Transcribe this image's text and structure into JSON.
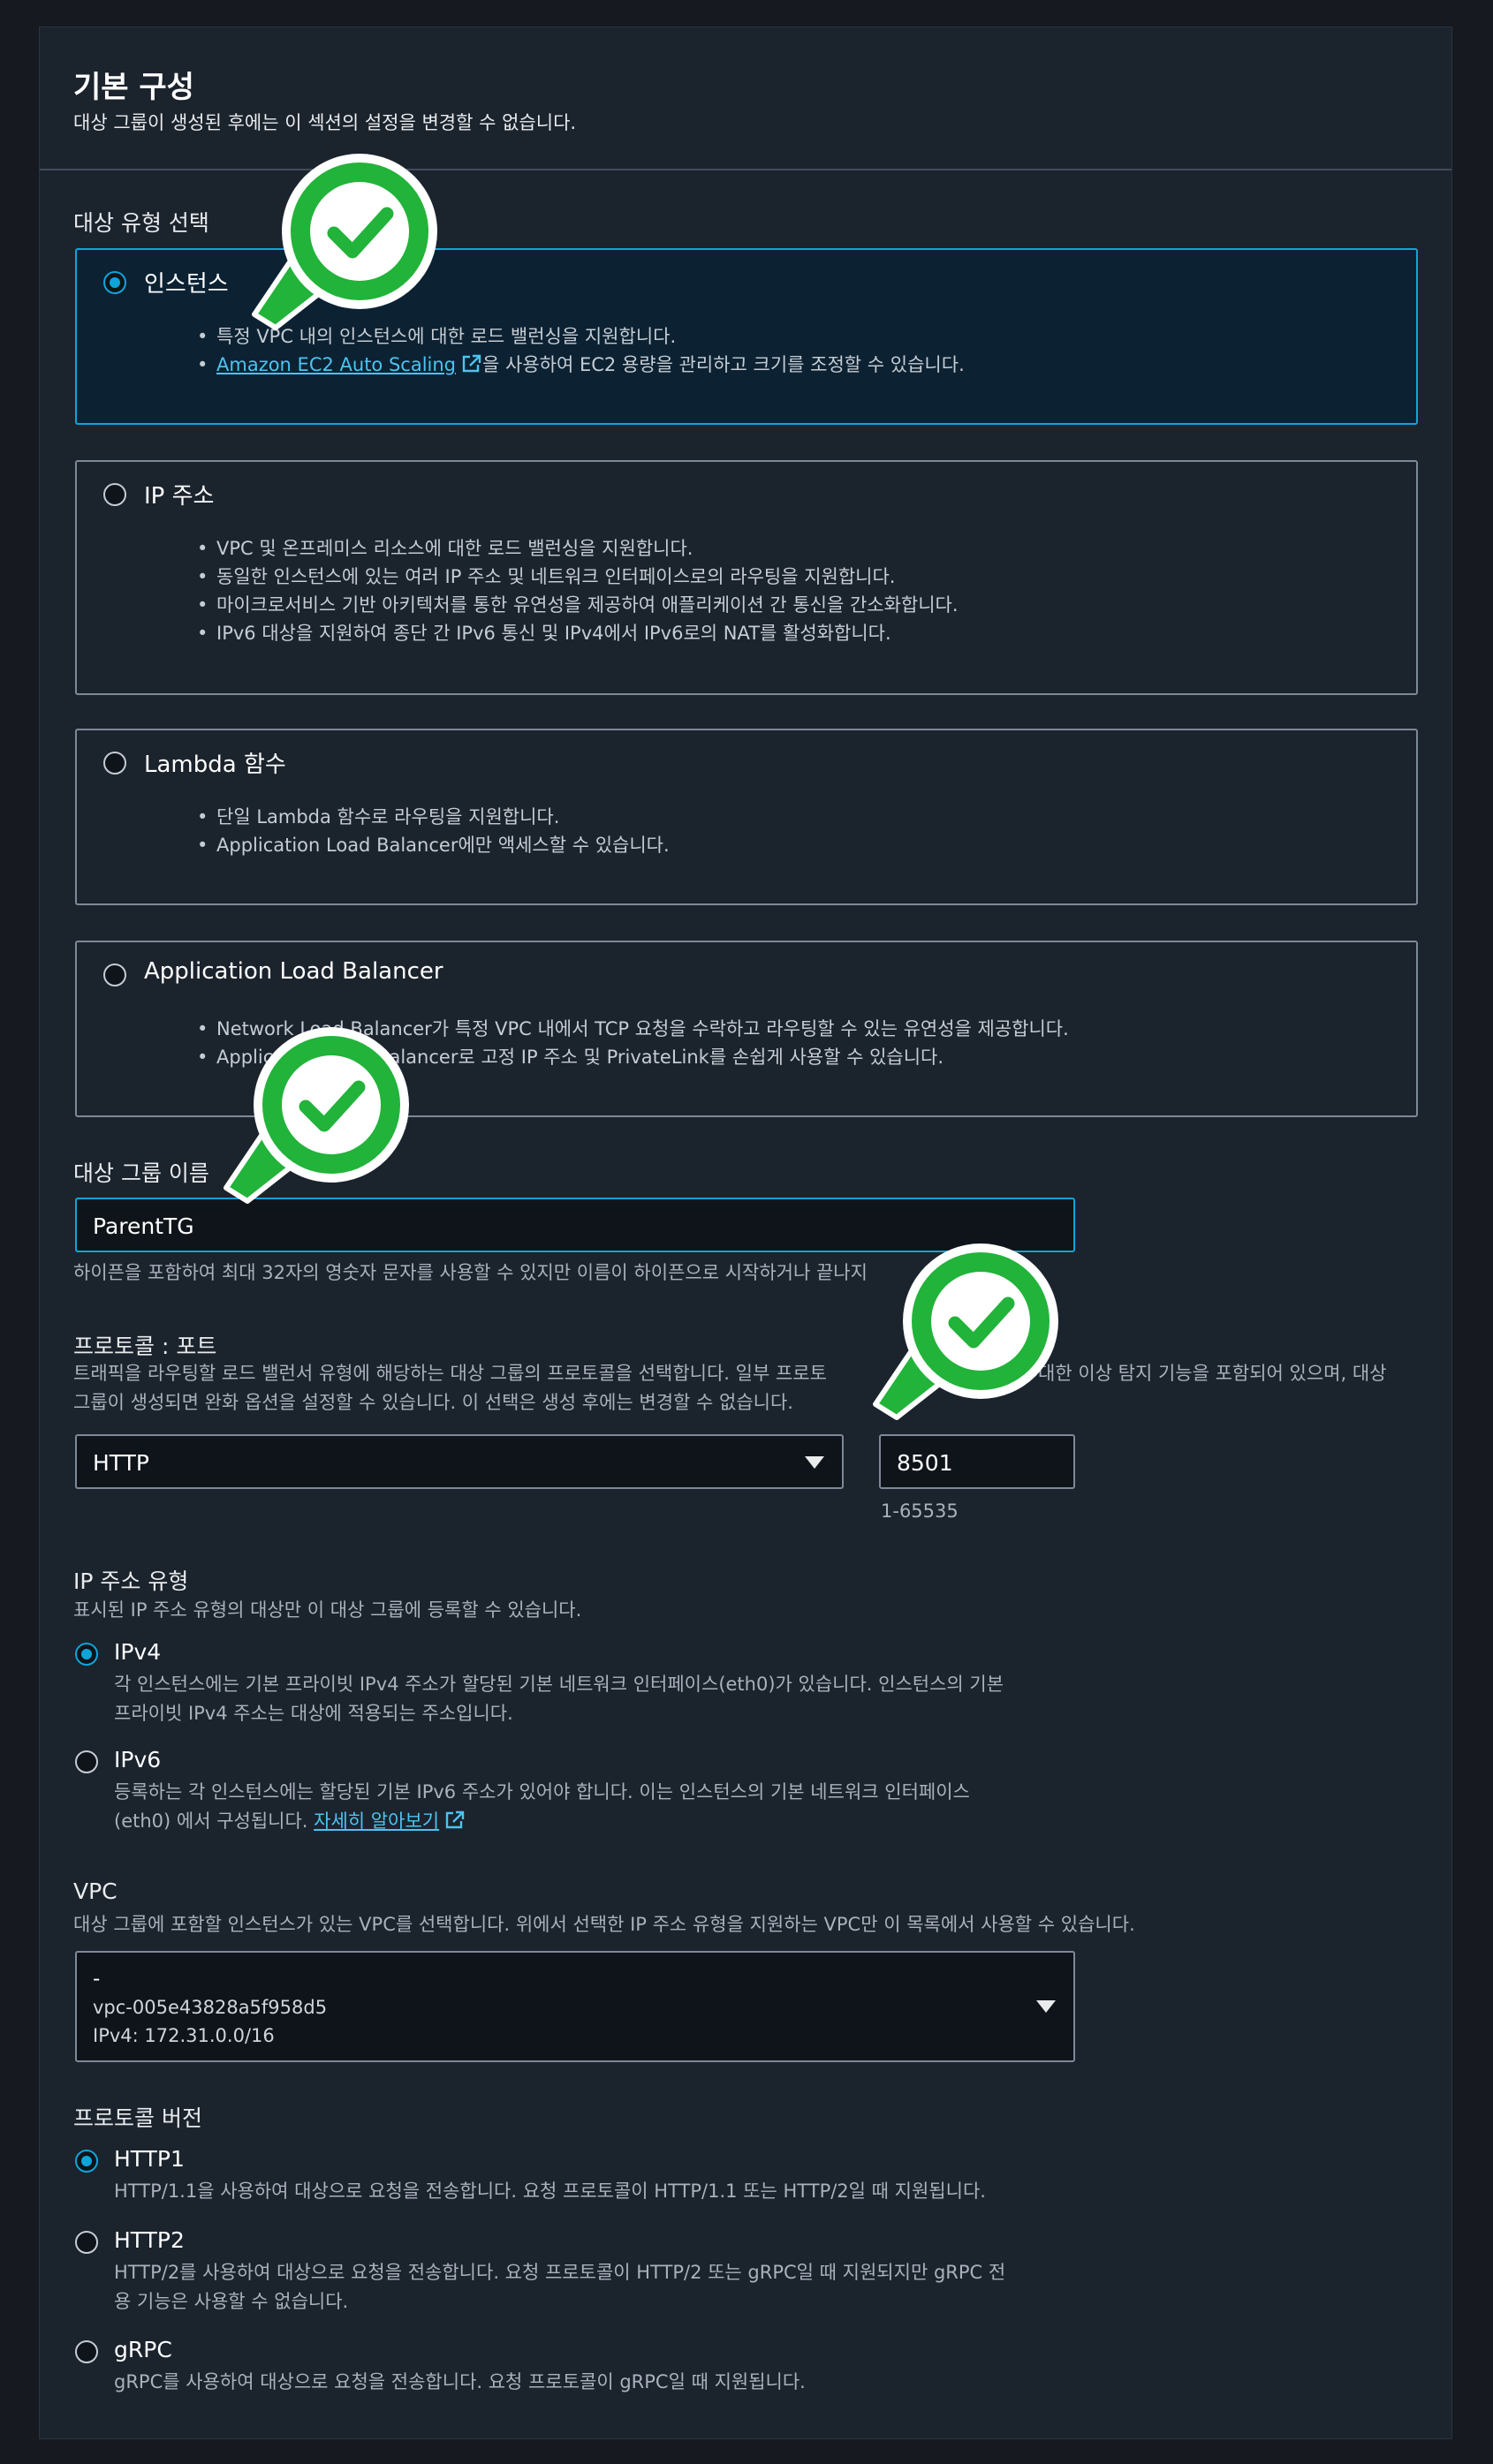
{
  "header": {
    "title": "기본 구성",
    "subtitle": "대상 그룹이 생성된 후에는 이 섹션의 설정을 변경할 수 없습니다."
  },
  "target_type": {
    "label": "대상 유형 선택",
    "options": [
      {
        "title": "인스턴스",
        "selected": true,
        "bullets": [
          "특정 VPC 내의 인스턴스에 대한 로드 밸런싱을 지원합니다."
        ],
        "link_text": "Amazon EC2 Auto Scaling",
        "link_suffix": "을 사용하여 EC2 용량을 관리하고 크기를 조정할 수 있습니다."
      },
      {
        "title": "IP 주소",
        "selected": false,
        "bullets": [
          "VPC 및 온프레미스 리소스에 대한 로드 밸런싱을 지원합니다.",
          "동일한 인스턴스에 있는 여러 IP 주소 및 네트워크 인터페이스로의 라우팅을 지원합니다.",
          "마이크로서비스 기반 아키텍처를 통한 유연성을 제공하여 애플리케이션 간 통신을 간소화합니다.",
          "IPv6 대상을 지원하여 종단 간 IPv6 통신 및 IPv4에서 IPv6로의 NAT를 활성화합니다."
        ]
      },
      {
        "title": "Lambda 함수",
        "selected": false,
        "bullets": [
          "단일 Lambda 함수로 라우팅을 지원합니다.",
          "Application Load Balancer에만 액세스할 수 있습니다."
        ]
      },
      {
        "title": "Application Load Balancer",
        "selected": false,
        "bullets": [
          "Network Load Balancer가 특정 VPC 내에서 TCP 요청을 수락하고 라우팅할 수 있는 유연성을 제공합니다.",
          "Application Load Balancer로 고정 IP 주소 및 PrivateLink를 손쉽게 사용할 수 있습니다."
        ]
      }
    ]
  },
  "target_group_name": {
    "label": "대상 그룹 이름",
    "value": "ParentTG",
    "hint": "하이픈을 포함하여 최대 32자의 영숫자 문자를 사용할 수 있지만 이름이 하이픈으로 시작하거나 끝나지"
  },
  "protocol_port": {
    "label": "프로토콜 : 포트",
    "hint_line1": "트래픽을 라우팅할 로드 밸런서 유형에 해당하는 대상 그룹의 프로토콜을 선택합니다. 일부 프로토",
    "hint_line1b": "대한 이상 탐지 기능을 포함되어 있으며, 대상",
    "hint_line2": "그룹이 생성되면 완화 옵션을 설정할 수 있습니다. 이 선택은 생성 후에는 변경할 수 없습니다.",
    "protocol": "HTTP",
    "port": "8501",
    "port_range": "1-65535"
  },
  "ip_address_type": {
    "label": "IP 주소 유형",
    "hint": "표시된 IP 주소 유형의 대상만 이 대상 그룹에 등록할 수 있습니다.",
    "options": [
      {
        "title": "IPv4",
        "selected": true,
        "desc_line1": "각 인스턴스에는 기본 프라이빗 IPv4 주소가 할당된 기본 네트워크 인터페이스(eth0)가 있습니다. 인스턴스의 기본",
        "desc_line2": "프라이빗 IPv4 주소는 대상에 적용되는 주소입니다."
      },
      {
        "title": "IPv6",
        "selected": false,
        "desc_line1": "등록하는 각 인스턴스에는 할당된 기본 IPv6 주소가 있어야 합니다. 이는 인스턴스의 기본 네트워크 인터페이스",
        "desc_line2": "(eth0) 에서 구성됩니다.",
        "link_text": "자세히 알아보기"
      }
    ]
  },
  "vpc": {
    "label": "VPC",
    "hint": "대상 그룹에 포함할 인스턴스가 있는 VPC를 선택합니다. 위에서 선택한 IP 주소 유형을 지원하는 VPC만 이 목록에서 사용할 수 있습니다.",
    "name": "-",
    "id": "vpc-005e43828a5f958d5",
    "cidr": "IPv4: 172.31.0.0/16"
  },
  "protocol_version": {
    "label": "프로토콜 버전",
    "options": [
      {
        "title": "HTTP1",
        "selected": true,
        "desc_line1": "HTTP/1.1을 사용하여 대상으로 요청을 전송합니다. 요청 프로토콜이 HTTP/1.1 또는 HTTP/2일 때 지원됩니다."
      },
      {
        "title": "HTTP2",
        "selected": false,
        "desc_line1": "HTTP/2를 사용하여 대상으로 요청을 전송합니다. 요청 프로토콜이 HTTP/2 또는 gRPC일 때 지원되지만 gRPC 전",
        "desc_line2": "용 기능은 사용할 수 없습니다."
      },
      {
        "title": "gRPC",
        "selected": false,
        "desc_line1": "gRPC를 사용하여 대상으로 요청을 전송합니다. 요청 프로토콜이 gRPC일 때 지원됩니다."
      }
    ]
  },
  "colors": {
    "accent": "#0ea5d9",
    "link": "#4dc3f0",
    "badge_green": "#22b33a",
    "panel_bg": "#1b232d"
  },
  "icons": [
    "external-link-icon",
    "check-badge-icon",
    "caret-down-icon"
  ]
}
